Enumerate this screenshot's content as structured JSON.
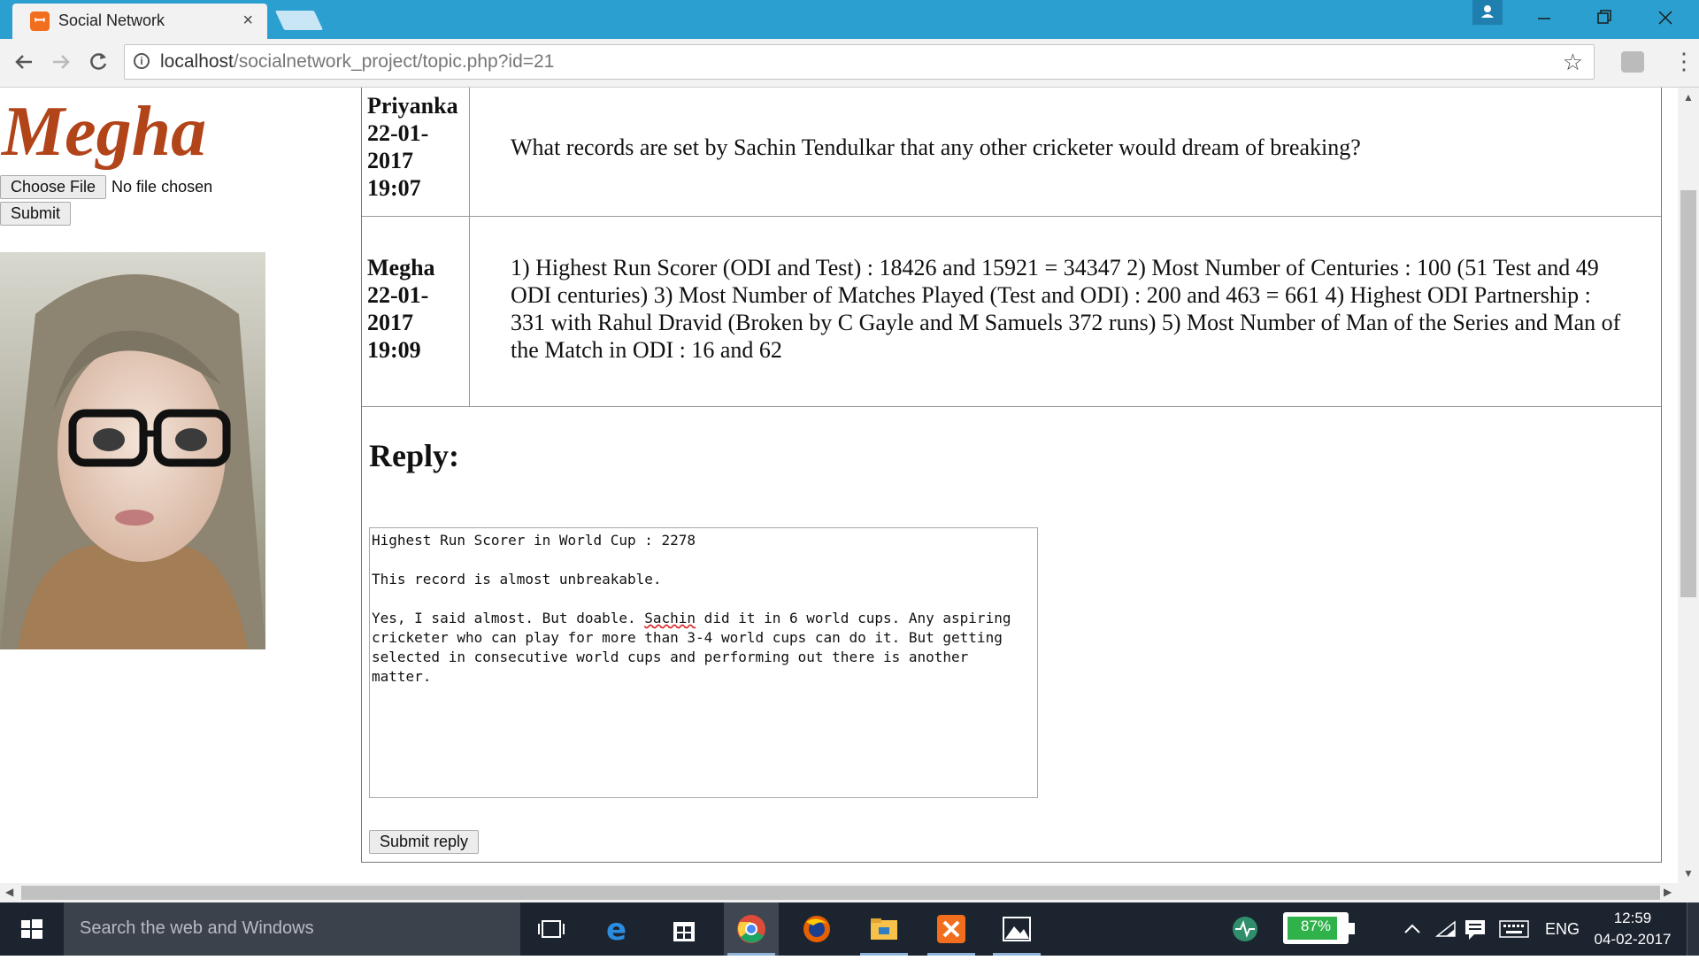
{
  "browser": {
    "tab_title": "Social Network",
    "tab_close": "×",
    "url_host": "localhost",
    "url_path": "/socialnetwork_project/topic.php?id=21"
  },
  "sidebar": {
    "name": "Megha",
    "choose_file_label": "Choose File",
    "file_status": "No file chosen",
    "submit_label": "Submit"
  },
  "posts": [
    {
      "author": "Priyanka",
      "date": "22-01-2017",
      "time": "19:07",
      "text": "What records are set by Sachin Tendulkar that any other cricketer would dream of breaking?"
    },
    {
      "author": "Megha",
      "date": "22-01-2017",
      "time": "19:09",
      "text": "1) Highest Run Scorer (ODI and Test) : 18426 and 15921 = 34347 2) Most Number of Centuries : 100 (51 Test and 49 ODI centuries) 3) Most Number of Matches Played (Test and ODI) : 200 and 463 = 661 4) Highest ODI Partnership : 331 with Rahul Dravid (Broken by C Gayle and M Samuels 372 runs) 5) Most Number of Man of the Series and Man of the Match in ODI : 16 and 62"
    }
  ],
  "reply": {
    "heading": "Reply:",
    "line1": "Highest Run Scorer in World Cup : 2278",
    "line2": "This record is almost unbreakable.",
    "line3_pre": "Yes, I said almost. But doable. ",
    "line3_misspelled": "Sachin",
    "line3_post": " did it in 6 world cups. Any aspiring cricketer who can play for more than 3-4 world cups can do it. But getting selected in consecutive world cups and performing out there is another matter.",
    "submit_label": "Submit reply"
  },
  "taskbar": {
    "search_placeholder": "Search the web and Windows",
    "battery_percent": 87,
    "battery_label": "87%",
    "language": "ENG",
    "time": "12:59",
    "date": "04-02-2017",
    "icons": [
      "task-view-icon",
      "edge-icon",
      "store-icon",
      "chrome-icon",
      "firefox-icon",
      "file-explorer-icon",
      "xampp-icon",
      "photos-icon"
    ]
  },
  "colors": {
    "titlebar": "#2b9fd0",
    "name_accent": "#b2441a",
    "taskbar": "#1c2430",
    "battery_green": "#2fb24a"
  }
}
